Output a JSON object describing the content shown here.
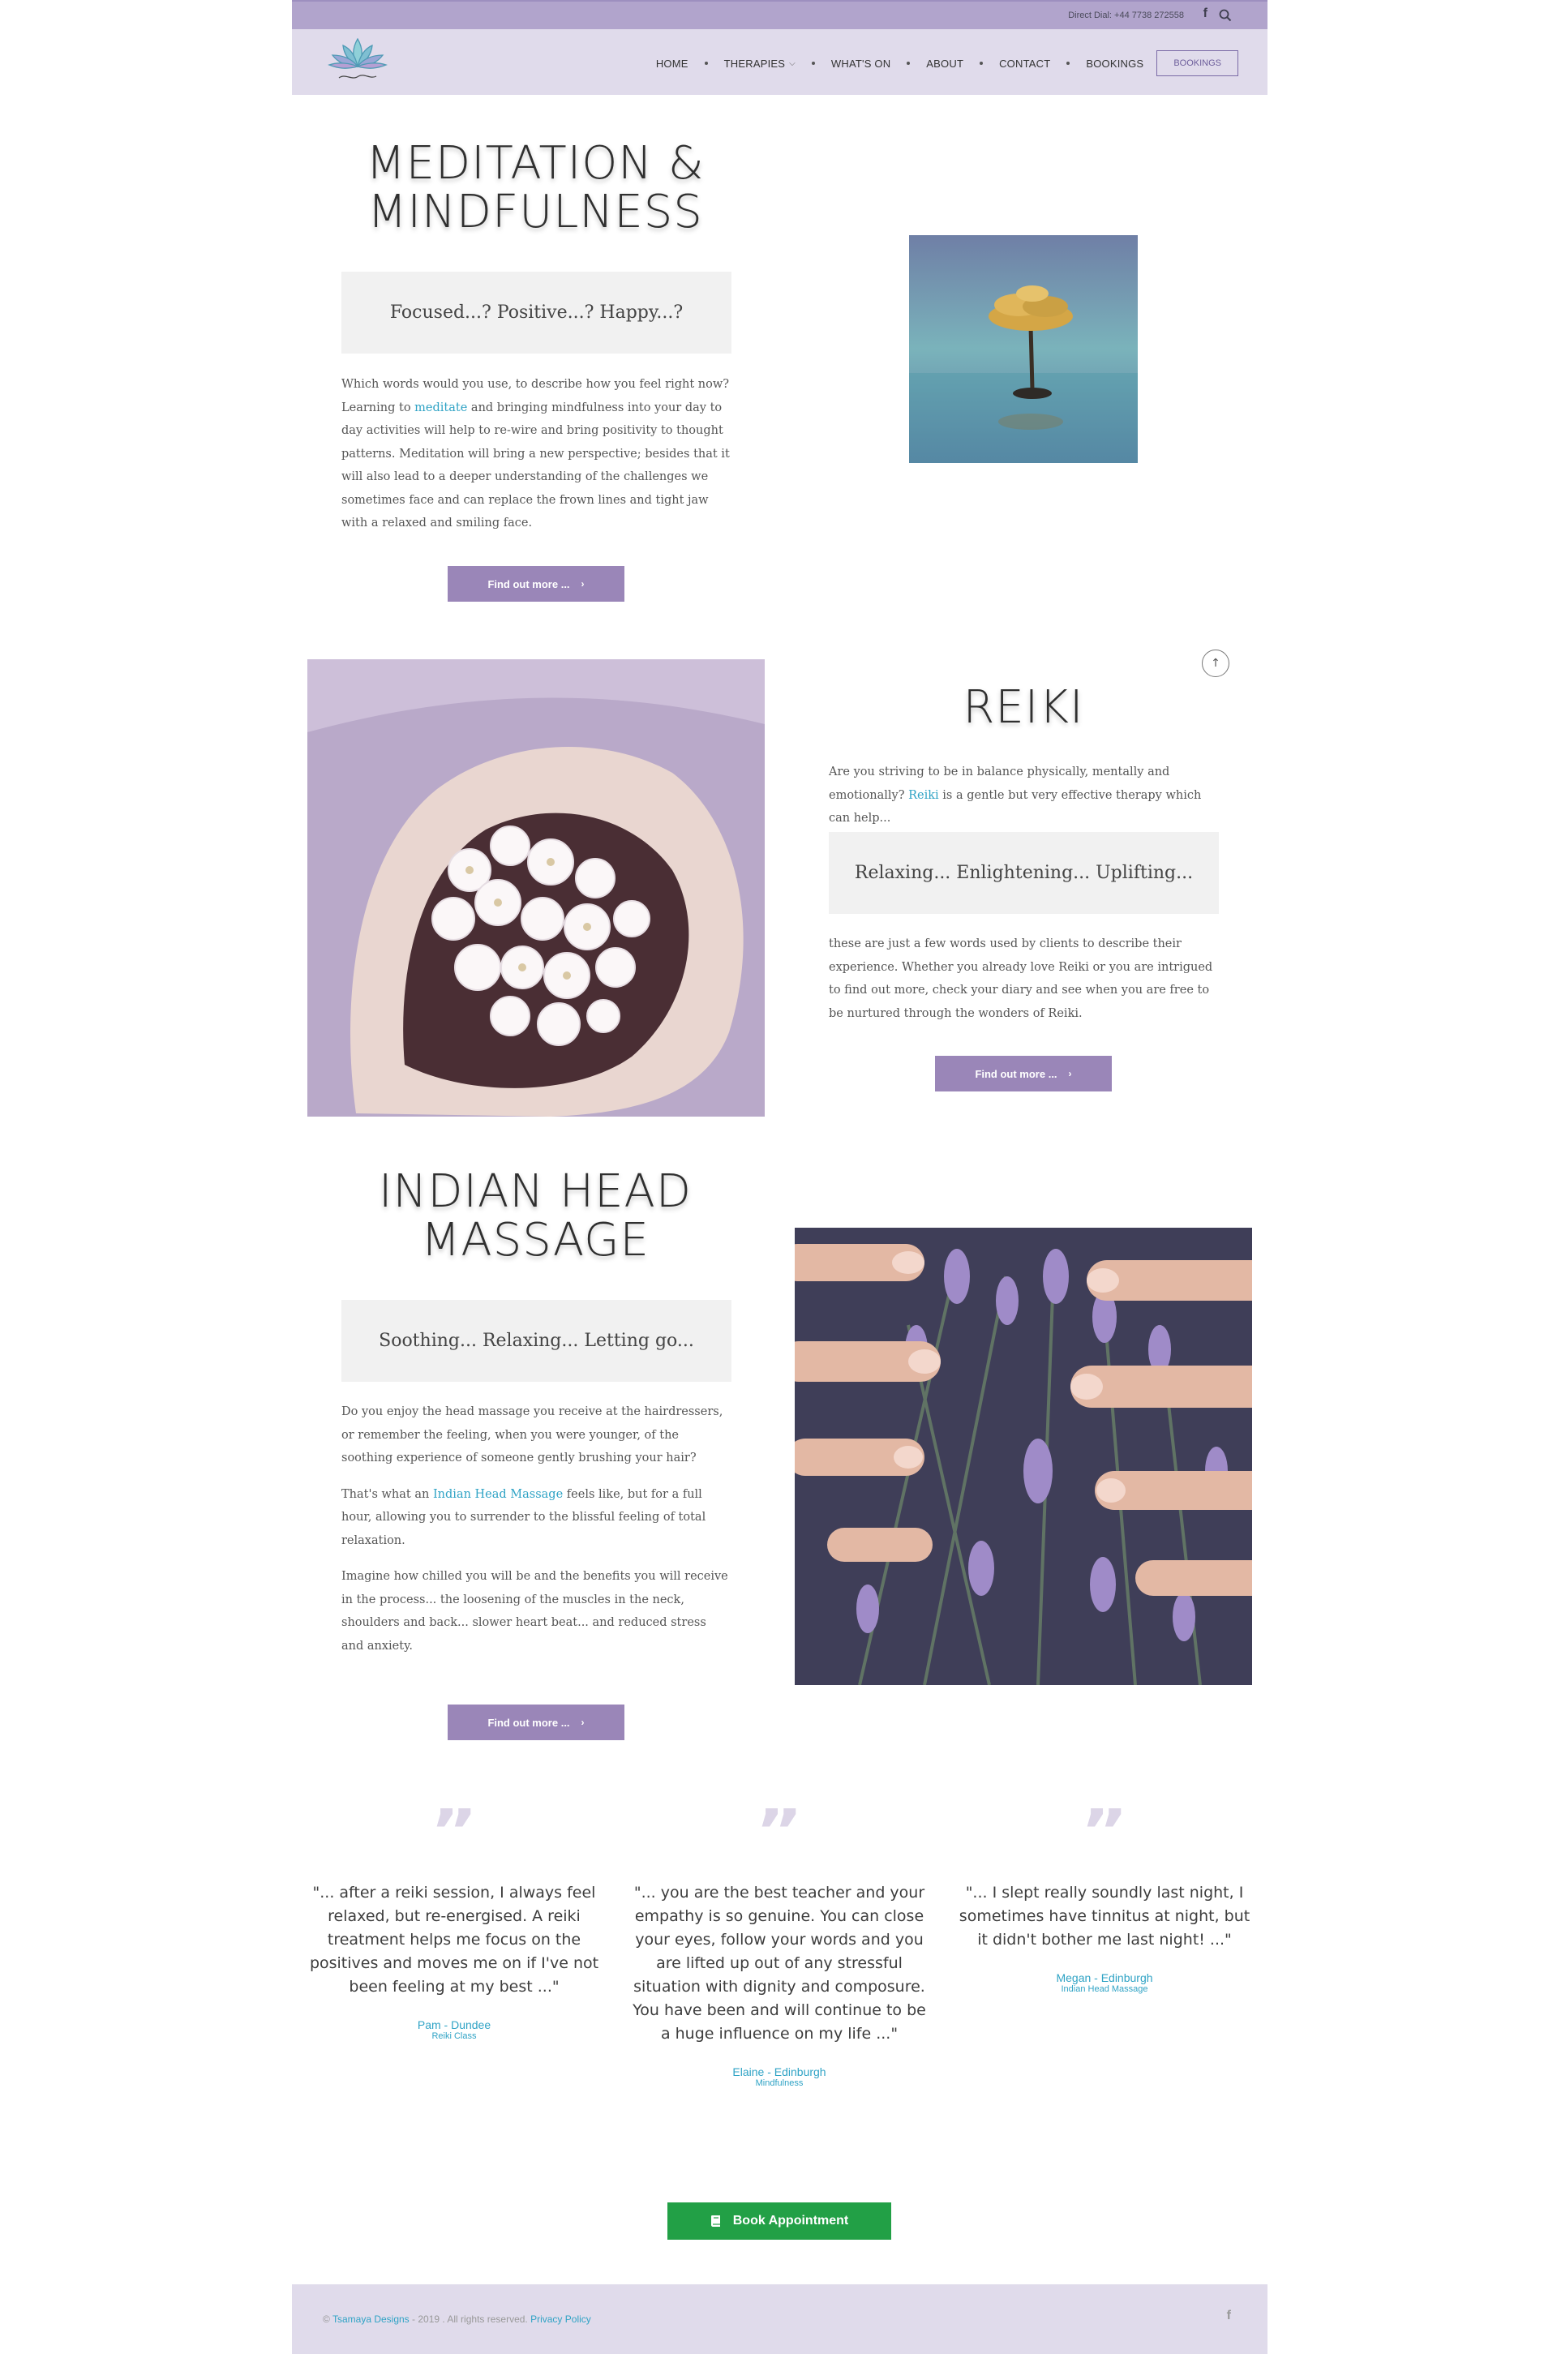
{
  "topbar": {
    "direct_dial": "Direct Dial: +44 7738 272558",
    "facebook_icon": "f"
  },
  "nav": {
    "items": [
      "HOME",
      "THERAPIES",
      "WHAT'S ON",
      "ABOUT",
      "CONTACT",
      "BOOKINGS"
    ],
    "button": "BOOKINGS"
  },
  "sections": {
    "meditation": {
      "title_line1": "MEDITATION &",
      "title_line2": "MINDFULNESS",
      "tagline": "Focused...? Positive...? Happy...?",
      "para_before_link": "Which words would you use, to describe how you feel right now? Learning to ",
      "link": "meditate",
      "para_after_link": " and bringing mindfulness into your day to day activities will help to re-wire and bring positivity to thought patterns. Meditation will bring a new perspective; besides that it will also lead to a deeper understanding of the challenges we sometimes face and can replace the frown lines and tight jaw with a relaxed and smiling face.",
      "button": "Find out more ..."
    },
    "reiki": {
      "title": "REIKI",
      "intro_before_link": "Are you striving to be in balance physically, mentally and emotionally? ",
      "link": "Reiki",
      "intro_after_link": " is a gentle but very effective therapy which can help...",
      "tagline": "Relaxing... Enlightening... Uplifting...",
      "para": "these are just a few words used by clients to describe their experience. Whether you already love Reiki or you are intrigued to find out more, check your diary and see when you are free to be nurtured through the wonders of Reiki.",
      "button": "Find out more ..."
    },
    "ihm": {
      "title_line1": "INDIAN HEAD",
      "title_line2": "MASSAGE",
      "tagline": "Soothing... Relaxing... Letting go...",
      "p1": "Do you enjoy the head massage you receive at the hairdressers, or remember the feeling, when you were younger, of the soothing experience of someone gently brushing your hair?",
      "p2_before_link": "That's what an ",
      "p2_link": "Indian Head Massage",
      "p2_after_link": " feels like, but for a full hour, allowing you to surrender to the blissful feeling of total relaxation.",
      "p3": "Imagine how chilled you will be and the benefits you will receive in the process... the loosening of the muscles in the neck, shoulders and back... slower heart beat... and reduced stress and anxiety.",
      "button": "Find out more ..."
    }
  },
  "testimonials": [
    {
      "text": "\"... after a reiki session, I always feel relaxed, but re-energised. A reiki treatment helps me focus on the positives and moves me on if I've not been feeling at my best ...\"",
      "name": "Pam - Dundee",
      "class": "Reiki Class"
    },
    {
      "text": "\"... you are the best teacher and your empathy is so genuine. You can close your eyes, follow your words and you are lifted up out of any stressful situation with dignity and composure. You have been and will continue to be a huge influence on my life ...\"",
      "name": "Elaine - Edinburgh",
      "class": "Mindfulness"
    },
    {
      "text": "\"... I slept really soundly last night, I sometimes have tinnitus at night, but it didn't bother me last night! ...\"",
      "name": "Megan - Edinburgh",
      "class": "Indian Head Massage"
    }
  ],
  "book_button": "Book Appointment",
  "footer": {
    "copyright_prefix": "© ",
    "designer": "Tsamaya Designs",
    "middle": " - 2019 . All rights reserved. ",
    "privacy": "Privacy Policy",
    "facebook_icon": "f"
  },
  "scroll_top_icon": "↑",
  "quote_glyph": "”",
  "colors": {
    "lavender_dark": "#b1a4cc",
    "lavender_light": "#e0dbeb",
    "button_purple": "#9a86b8",
    "link_blue": "#2fa3c5",
    "book_green": "#22a046"
  }
}
